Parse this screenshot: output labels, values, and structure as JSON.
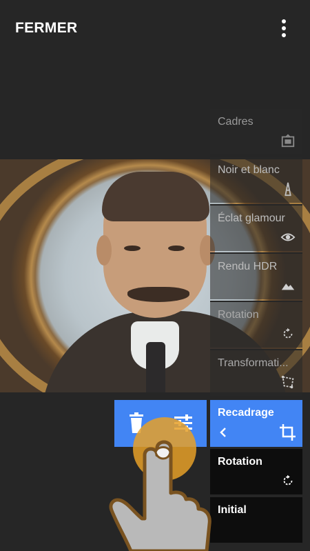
{
  "header": {
    "close_label": "FERMER",
    "more_icon": "more-vert-icon"
  },
  "menu": {
    "items": [
      {
        "label": "Cadres",
        "icon": "frame-icon"
      },
      {
        "label": "Noir et blanc",
        "icon": "tower-icon"
      },
      {
        "label": "Éclat glamour",
        "icon": "eye-icon"
      },
      {
        "label": "Rendu HDR",
        "icon": "mountain-icon"
      },
      {
        "label": "Rotation",
        "icon": "rotate-icon"
      },
      {
        "label": "Transformati...",
        "icon": "perspective-icon"
      }
    ]
  },
  "stack": {
    "active_label": "Recadrage",
    "rotation_label": "Rotation",
    "initial_label": "Initial"
  },
  "actions": {
    "delete_icon": "trash-icon",
    "tune_icon": "tune-icon"
  },
  "colors": {
    "accent": "#4285f4",
    "background": "#262626",
    "touch": "#e6a028"
  }
}
